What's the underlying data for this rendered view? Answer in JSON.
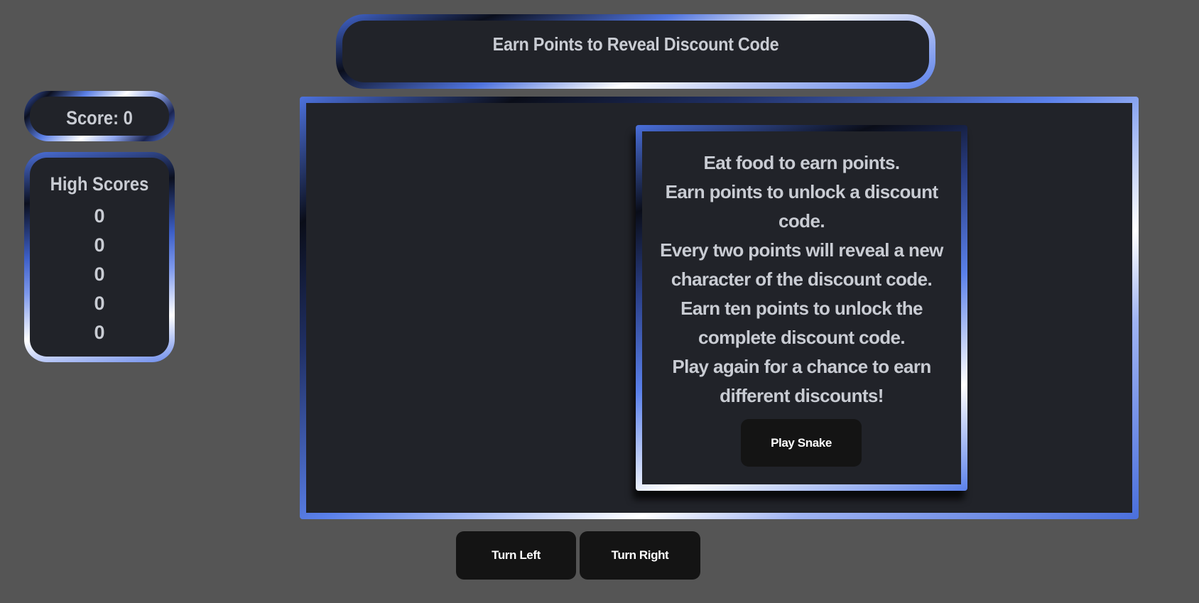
{
  "header": {
    "title": "Earn Points to Reveal Discount Code"
  },
  "score": {
    "label": "Score: 0"
  },
  "high_scores": {
    "title": "High Scores",
    "values": [
      "0",
      "0",
      "0",
      "0",
      "0"
    ]
  },
  "modal": {
    "instructions": [
      "Eat food to earn points.",
      "Earn points to unlock a discount code.",
      "Every two points will reveal a new character of the discount code.",
      "Earn ten points to unlock the complete discount code.",
      "Play again for a chance to earn different discounts!"
    ],
    "play_button": "Play Snake"
  },
  "controls": {
    "turn_left": "Turn Left",
    "turn_right": "Turn Right"
  },
  "colors": {
    "background": "#555555",
    "panel": "#212329",
    "accent": "#5a80ea",
    "button": "#141414",
    "text": "#c9ccd3"
  }
}
